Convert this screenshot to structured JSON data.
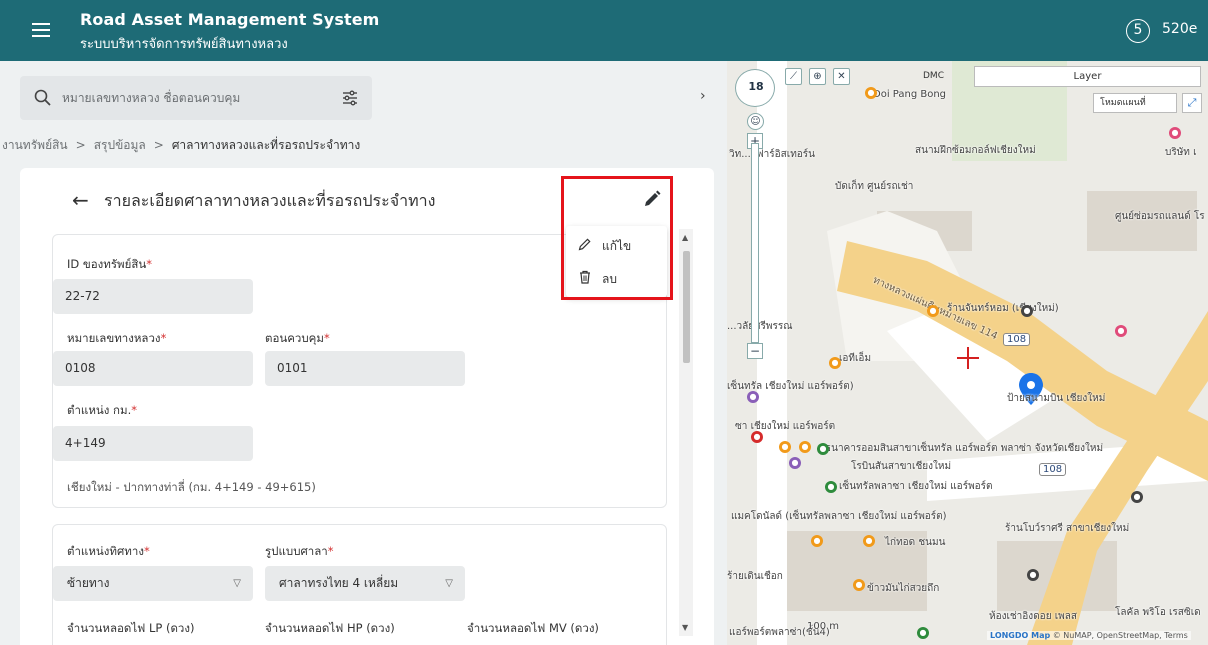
{
  "header": {
    "title": "Road Asset Management System",
    "subtitle": "ระบบบริหารจัดการทรัพย์สินทางหลวง",
    "notification_count": "5",
    "user_code": "520e"
  },
  "search": {
    "placeholder": "หมายเลขทางหลวง ชื่อตอนควบคุม"
  },
  "breadcrumb": {
    "items": [
      "งานทรัพย์สิน",
      "สรุปข้อมูล",
      "ศาลาทางหลวงและที่รอรถประจำทาง"
    ],
    "separator": ">"
  },
  "detail": {
    "title": "รายละเอียดศาลาทางหลวงและที่รอรถประจำทาง",
    "fields": {
      "asset_id": {
        "label": "ID ของทรัพย์สิน",
        "value": "22-72"
      },
      "highway_no": {
        "label": "หมายเลขทางหลวง",
        "value": "0108"
      },
      "control_section": {
        "label": "ตอนควบคุม",
        "value": "0101"
      },
      "km_position": {
        "label": "ตำแหน่ง กม.",
        "value": "4+149"
      },
      "section_desc": "เชียงใหม่ - ปากทางท่าลี่ (กม. 4+149 - 49+615)",
      "direction": {
        "label": "ตำแหน่งทิศทาง",
        "value": "ซ้ายทาง"
      },
      "shelter_type": {
        "label": "รูปแบบศาลา",
        "value": "ศาลาทรงไทย 4 เหลี่ยม"
      },
      "lp_lamps": {
        "label": "จำนวนหลอดไฟ LP (ดวง)"
      },
      "hp_lamps": {
        "label": "จำนวนหลอดไฟ HP (ดวง)"
      },
      "mv_lamps": {
        "label": "จำนวนหลอดไฟ MV (ดวง)"
      }
    },
    "required_mark": "*"
  },
  "action_menu": {
    "edit_label": "แก้ไข",
    "delete_label": "ลบ"
  },
  "map": {
    "zoom_level": "18",
    "dmc_label": "DMC",
    "layer_label": "Layer",
    "basemap_label": "โหมดแผนที่",
    "labels": {
      "doi_pang_bong": "Doi Pang Bong",
      "golf": "สนามฝึกซ้อมกอล์ฟเชียงใหม่",
      "company": "บริษัท เ",
      "resort": "วิท...ยฟาร์อิสเทอร์น",
      "bucket": "บัดเก็ท ศูนย์รถเช่า",
      "service_center": "ศูนย์ซ่อมรถแลนด์ โร",
      "road_name": "ทางหลวงแผ่นดินหมายเลข 114",
      "chanhom": "ร้านจันทร์หอม (เชียงใหม่)",
      "college": "...วลัยศรีพรรณ",
      "atm": "เอทีเอ็ม",
      "central_airport": "เซ็นทรัล เชียงใหม่ แอร์พอร์ต)",
      "airport_sign": "ป้ายสนามบิน เชียงใหม่",
      "route_108_a": "108",
      "route_108_b": "108",
      "airport_plaza": "ซา เชียงใหม่ แอร์พอร์ต",
      "gsb": "ธนาคารออมสินสาขาเซ็นทรัล แอร์พอร์ต พลาซ่า จังหวัดเชียงใหม่",
      "school": "โรบินสันสาขาเชียงใหม่",
      "central_plaza": "เซ็นทรัลพลาซา เชียงใหม่ แอร์พอร์ต",
      "mcdonalds": "แมคโดนัลด์ (เซ็นทรัลพลาซา เชียงใหม่ แอร์พอร์ต)",
      "bowrasri": "ร้านโบว์ราศรี สาขาเชียงใหม่",
      "kaitod": "ไก่ทอด ชนมน",
      "walking": "ร้ายเดินเชือก",
      "khao_man_kai": "ข้าวมันไก่สวยถึก",
      "doi_phet": "ห้องเช่าอิงดอย เพลส",
      "loft": "โลคัล พริโอ เรสซิเด",
      "airport_shop": "แอร์พอร์ตพลาซ่า(ชั้น4)",
      "scale": "100 m"
    },
    "attribution": {
      "brand": "LONGDO Map",
      "text": "© NuMAP, OpenStreetMap, Terms"
    }
  }
}
